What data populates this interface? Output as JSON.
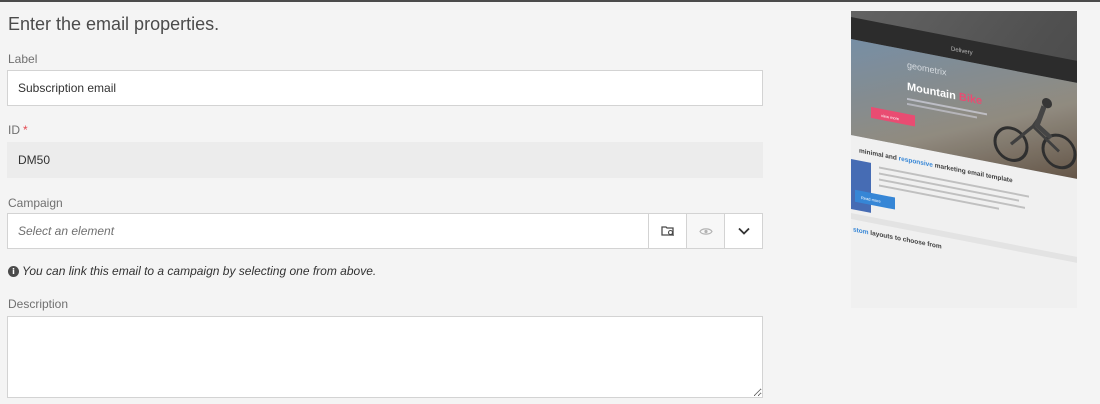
{
  "heading": "Enter the email properties.",
  "fields": {
    "label": {
      "label": "Label",
      "value": "Subscription email"
    },
    "id": {
      "label": "ID",
      "required_marker": "*",
      "value": "DM50"
    },
    "campaign": {
      "label": "Campaign",
      "placeholder": "Select an element"
    },
    "campaign_hint": "You can link this email to a campaign by selecting one from above.",
    "description": {
      "label": "Description",
      "value": ""
    }
  },
  "preview": {
    "window_title": "Delivery",
    "brand": "geometrix",
    "headline_part1": "Mountain ",
    "headline_part2": "Bike",
    "cta": "view more",
    "section_title_part1": "minimal and ",
    "section_title_part2": "responsive",
    "section_title_part3": " marketing email template",
    "section_cta": "Read more",
    "footer_text_part1": "stom",
    "footer_text_part2": " layouts to choose from",
    "accent_color": "#e8416a",
    "link_color": "#2a7fd4"
  },
  "icons": {
    "info": "info-icon",
    "browse": "folder-browse-icon",
    "view": "eye-icon",
    "dropdown": "chevron-down-icon"
  }
}
